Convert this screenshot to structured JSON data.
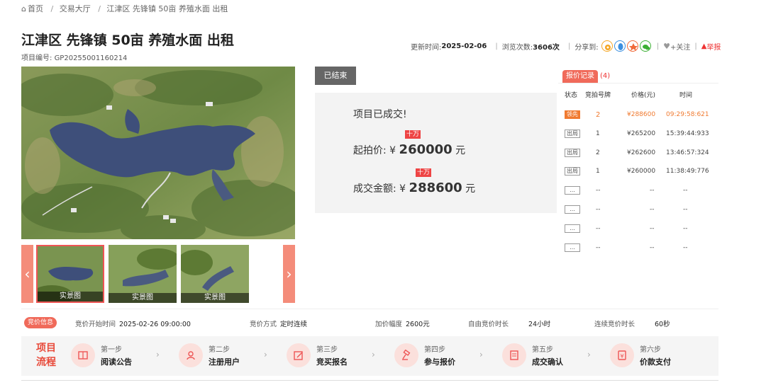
{
  "breadcrumb": {
    "home_icon": "home-icon",
    "home": "首页",
    "hall": "交易大厅",
    "current": "江津区 先锋镇 50亩 养殖水面 出租"
  },
  "project": {
    "title": "江津区 先锋镇 50亩 养殖水面 出租",
    "number_label": "项目编号:",
    "number": "GP20255001160214"
  },
  "meta": {
    "updated_label": "更新时间:",
    "updated": "2025-02-06",
    "views_label": "浏览次数:",
    "views": "3606次",
    "share_label": "分享到:",
    "share_colors": [
      "#f5a623",
      "#3b8fe0",
      "#f06a3a",
      "#3cb034"
    ],
    "follow": "+关注",
    "report": "举报"
  },
  "gallery": {
    "thumbs": [
      {
        "label": "实景图"
      },
      {
        "label": "实景图"
      },
      {
        "label": "实景图"
      }
    ]
  },
  "status": {
    "tag": "已结束",
    "result_text": "项目已成交!",
    "start_label": "起拍价:",
    "currency": "¥",
    "start_price": "260000",
    "unit": "元",
    "unit_badge": "十万",
    "deal_label": "成交金额:",
    "deal_price": "288600"
  },
  "records": {
    "title": "报价记录",
    "count": "(4)",
    "headers": [
      "状态",
      "竞拍号牌",
      "价格(元)",
      "时间"
    ],
    "rows": [
      {
        "status": "领先",
        "bidder": "2",
        "price": "¥288600",
        "time": "09:29:58:621"
      },
      {
        "status": "出局",
        "bidder": "1",
        "price": "¥265200",
        "time": "15:39:44:933"
      },
      {
        "status": "出局",
        "bidder": "2",
        "price": "¥262600",
        "time": "13:46:57:324"
      },
      {
        "status": "出局",
        "bidder": "1",
        "price": "¥260000",
        "time": "11:38:49:776"
      },
      {
        "status": "...",
        "bidder": "--",
        "price": "--",
        "time": "--"
      },
      {
        "status": "...",
        "bidder": "--",
        "price": "--",
        "time": "--"
      },
      {
        "status": "...",
        "bidder": "--",
        "price": "--",
        "time": "--"
      },
      {
        "status": "...",
        "bidder": "--",
        "price": "--",
        "time": "--"
      }
    ]
  },
  "bid_info": {
    "tag": "竞价信息",
    "items": [
      {
        "label": "竞价开始时间",
        "value": "2025-02-26 09:00:00"
      },
      {
        "label": "竞价方式",
        "value": "定时连续"
      },
      {
        "label": "加价幅度",
        "value": "2600元"
      },
      {
        "label": "自由竞价时长",
        "value": "24小时"
      },
      {
        "label": "连续竞价时长",
        "value": "60秒"
      }
    ]
  },
  "flow": {
    "title": "项目流程",
    "steps": [
      {
        "step": "第一步",
        "name": "阅读公告",
        "icon": "book-icon"
      },
      {
        "step": "第二步",
        "name": "注册用户",
        "icon": "user-icon"
      },
      {
        "step": "第三步",
        "name": "竞买报名",
        "icon": "edit-icon"
      },
      {
        "step": "第四步",
        "name": "参与报价",
        "icon": "gavel-icon"
      },
      {
        "step": "第五步",
        "name": "成交确认",
        "icon": "document-icon"
      },
      {
        "step": "第六步",
        "name": "价款支付",
        "icon": "payment-icon"
      }
    ]
  }
}
